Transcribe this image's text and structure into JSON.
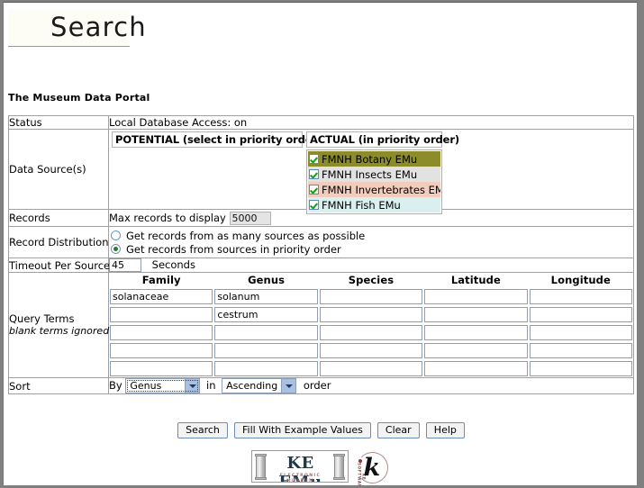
{
  "page": {
    "title": "Search",
    "portal_heading": "The Museum Data Portal"
  },
  "status": {
    "label": "Status",
    "value": "Local Database Access: on"
  },
  "data_source": {
    "label": "Data Source(s)",
    "potential_header": "POTENTIAL (select in priority order)",
    "actual_header": "ACTUAL (in priority order)",
    "potential_items": [],
    "actual_items": [
      {
        "label": "FMNH Botany EMu",
        "checked": true,
        "bg": "#8c8c2a"
      },
      {
        "label": "FMNH Insects EMu",
        "checked": true,
        "bg": "#e2e2e2"
      },
      {
        "label": "FMNH Invertebrates EMu",
        "checked": true,
        "bg": "#f2ccbc"
      },
      {
        "label": "FMNH Fish EMu",
        "checked": true,
        "bg": "#d9f0ee"
      }
    ]
  },
  "records": {
    "label": "Records",
    "max_label": "Max records to display",
    "max_value": "5000"
  },
  "record_distribution": {
    "label": "Record Distribution",
    "options": [
      {
        "label": "Get records from as many sources as possible",
        "selected": false
      },
      {
        "label": "Get records from sources in priority order",
        "selected": true
      }
    ]
  },
  "timeout": {
    "label": "Timeout Per Source",
    "value": "45",
    "units": "Seconds"
  },
  "query_terms": {
    "label": "Query Terms",
    "sublabel": "blank terms ignored",
    "columns": [
      "Family",
      "Genus",
      "Species",
      "Latitude",
      "Longitude"
    ],
    "rows": [
      [
        "solanaceae",
        "solanum",
        "",
        "",
        ""
      ],
      [
        "",
        "cestrum",
        "",
        "",
        ""
      ],
      [
        "",
        "",
        "",
        "",
        ""
      ],
      [
        "",
        "",
        "",
        "",
        ""
      ],
      [
        "",
        "",
        "",
        "",
        ""
      ]
    ]
  },
  "sort": {
    "label": "Sort",
    "by_label": "By",
    "field_value": "Genus",
    "in_label": "in",
    "direction_value": "Ascending",
    "order_label": "order"
  },
  "buttons": {
    "search": "Search",
    "fill_example": "Fill With Example Values",
    "clear": "Clear",
    "help": "Help"
  },
  "footer": {
    "keemu_name": "KE EMu",
    "keemu_tagline": "ELECTRONIC MUSEUM",
    "ke_software": "KE SOFTWARE"
  },
  "colors": {
    "botany": "#8c8c2a",
    "insects": "#e2e2e2",
    "invertebrates": "#f2ccbc",
    "fish": "#d9f0ee",
    "checkbox_border": "#5b88c4",
    "check_green": "#12a012",
    "input_border": "#8d9fb8",
    "table_border": "#a0a0a0"
  }
}
